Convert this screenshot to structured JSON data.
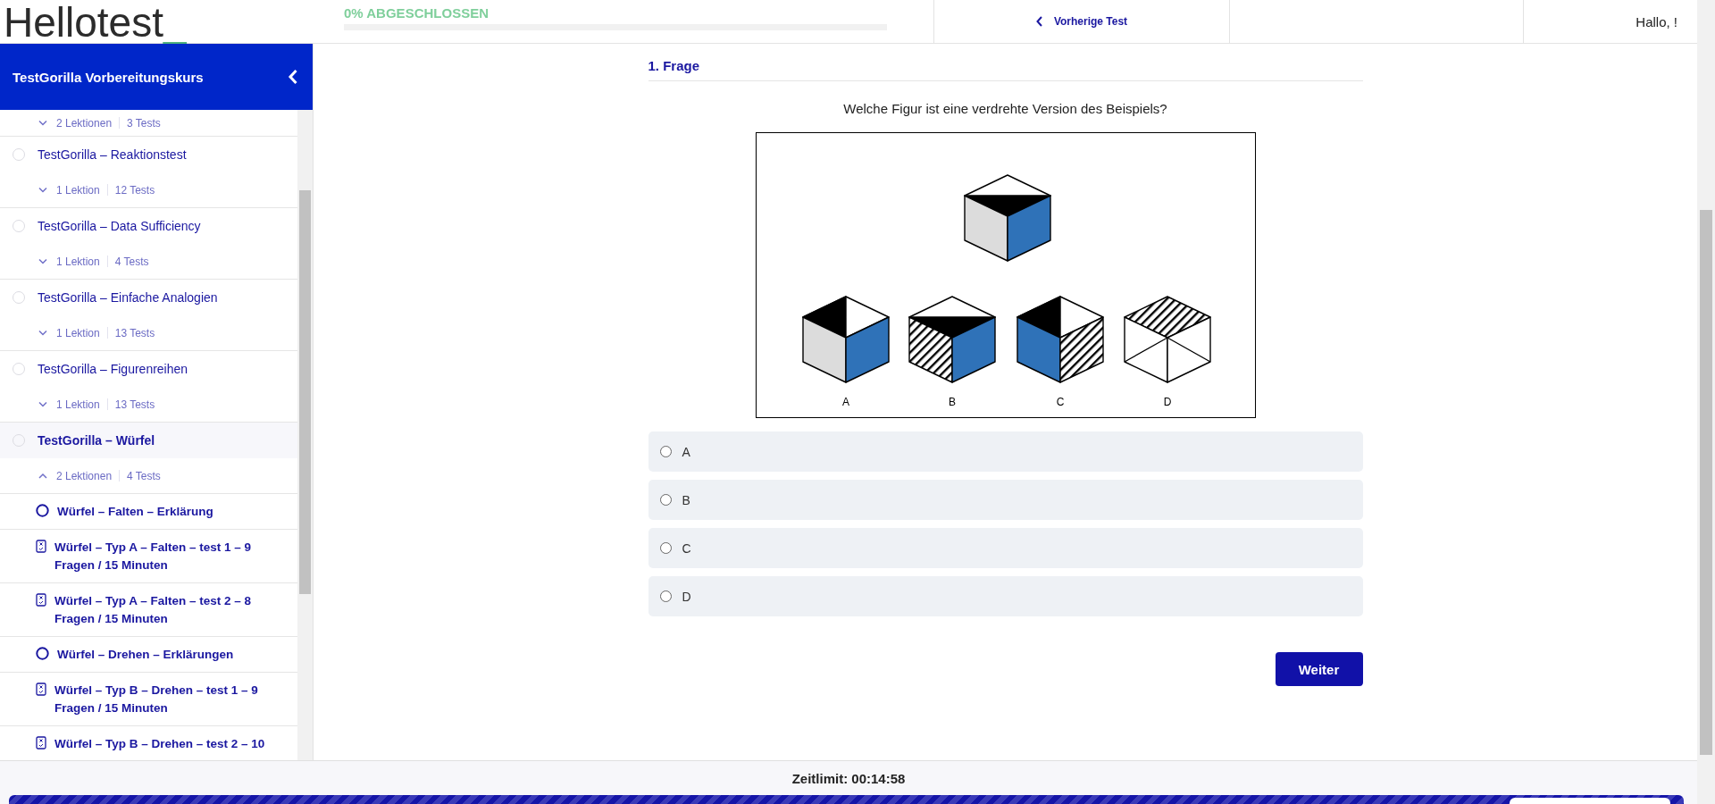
{
  "logo": {
    "text": "Hellotest",
    "cursor": "_"
  },
  "progress": {
    "label": "0% ABGESCHLOSSEN",
    "level": 0
  },
  "nav": {
    "previous": "Vorherige Test",
    "greeting": "Hallo, !"
  },
  "sidebar": {
    "title": "TestGorilla Vorbereitungskurs",
    "top_meta": {
      "lessons": "2 Lektionen",
      "tests": "3 Tests",
      "expanded": false
    },
    "sections": [
      {
        "title": "TestGorilla – Reaktionstest",
        "lessons": "1 Lektion",
        "tests": "12 Tests",
        "selected": false,
        "expanded": false
      },
      {
        "title": "TestGorilla – Data Sufficiency",
        "lessons": "1 Lektion",
        "tests": "4 Tests",
        "selected": false,
        "expanded": false
      },
      {
        "title": "TestGorilla – Einfache Analogien",
        "lessons": "1 Lektion",
        "tests": "13 Tests",
        "selected": false,
        "expanded": false
      },
      {
        "title": "TestGorilla – Figurenreihen",
        "lessons": "1 Lektion",
        "tests": "13 Tests",
        "selected": false,
        "expanded": false
      },
      {
        "title": "TestGorilla – Würfel",
        "lessons": "2 Lektionen",
        "tests": "4 Tests",
        "selected": true,
        "expanded": true,
        "children": [
          {
            "kind": "lesson",
            "title": "Würfel – Falten – Erklärung"
          },
          {
            "kind": "test",
            "title": "Würfel – Typ A – Falten – test 1 – 9 Fragen / 15 Minuten"
          },
          {
            "kind": "test",
            "title": "Würfel – Typ A – Falten – test 2 – 8 Fragen / 15 Minuten"
          },
          {
            "kind": "lesson",
            "title": "Würfel – Drehen – Erklärungen"
          },
          {
            "kind": "test",
            "title": "Würfel – Typ B – Drehen – test 1 – 9 Fragen / 15 Minuten"
          },
          {
            "kind": "test",
            "title": "Würfel – Typ B – Drehen – test 2 – 10"
          }
        ]
      }
    ]
  },
  "question": {
    "heading": "1. Frage",
    "text": "Welche Figur ist eine verdrehte Version des Beispiels?",
    "figure_labels": [
      "A",
      "B",
      "C",
      "D"
    ],
    "options": [
      {
        "label": "A",
        "selected": false
      },
      {
        "label": "B",
        "selected": false
      },
      {
        "label": "C",
        "selected": false
      },
      {
        "label": "D",
        "selected": false
      }
    ],
    "next_button": "Weiter"
  },
  "timer": {
    "label": "Zeitlimit: 00:14:58"
  }
}
